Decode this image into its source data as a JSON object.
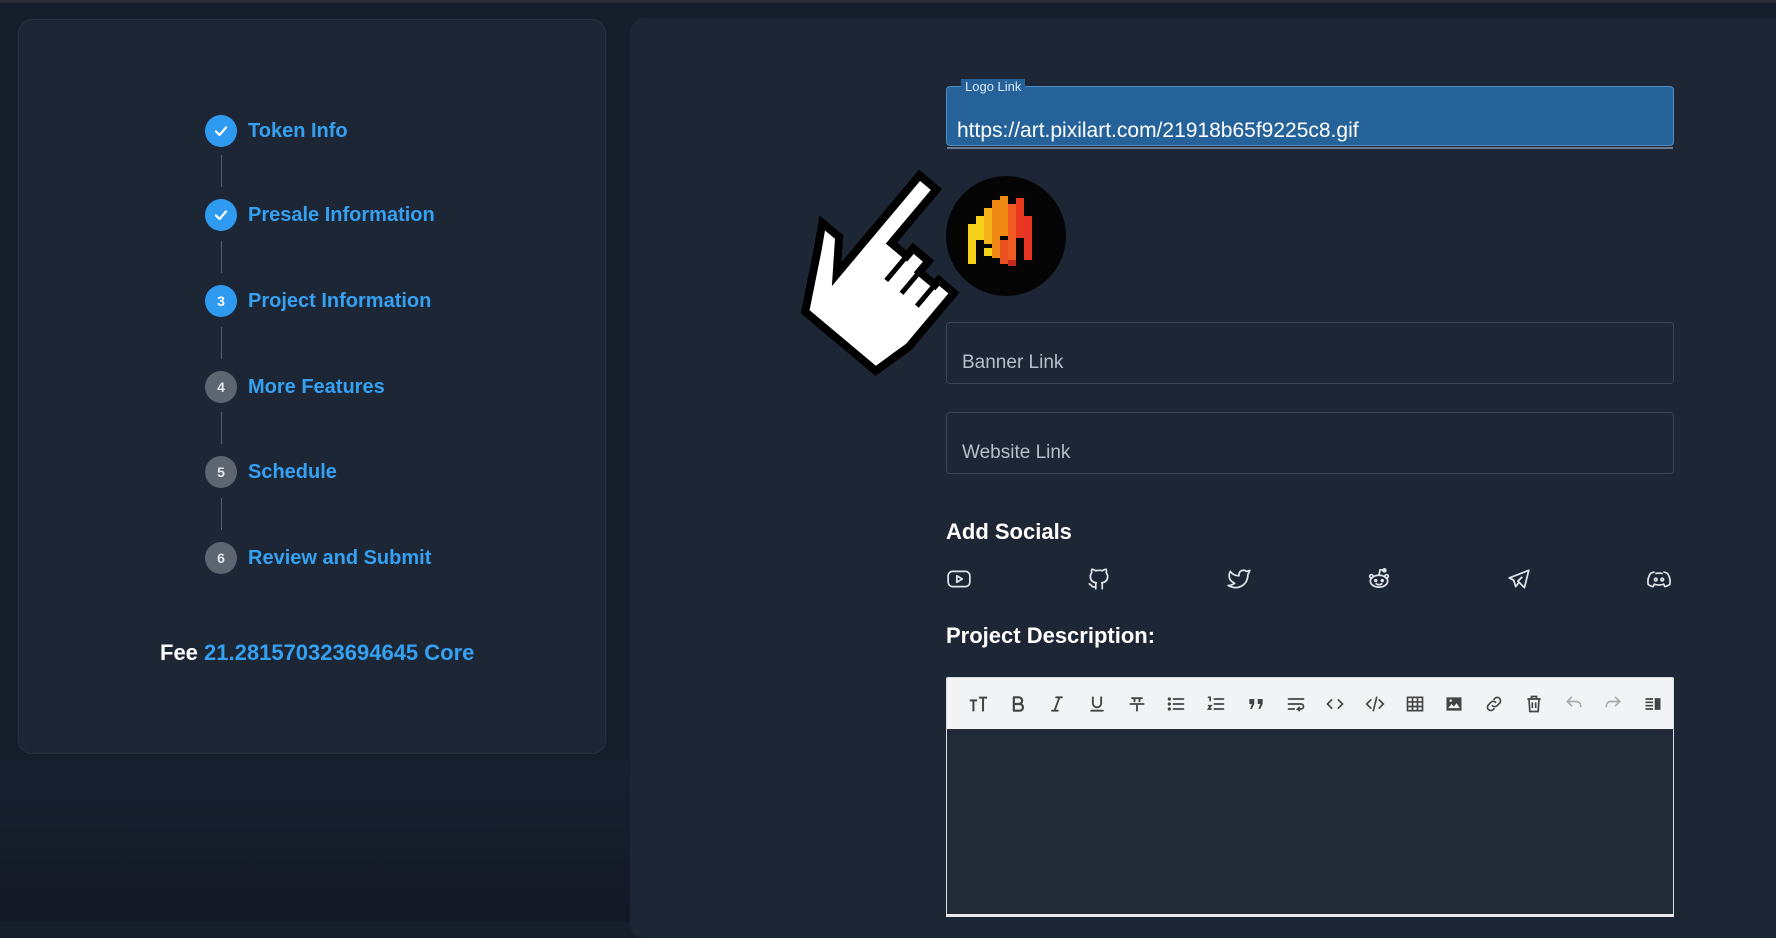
{
  "stepper": {
    "steps": [
      {
        "number": "1",
        "label": "Token Info",
        "status": "completed"
      },
      {
        "number": "2",
        "label": "Presale Information",
        "status": "completed"
      },
      {
        "number": "3",
        "label": "Project Information",
        "status": "active"
      },
      {
        "number": "4",
        "label": "More Features",
        "status": "pending"
      },
      {
        "number": "5",
        "label": "Schedule",
        "status": "pending"
      },
      {
        "number": "6",
        "label": "Review and Submit",
        "status": "pending"
      }
    ],
    "fee_label": "Fee",
    "fee_value": "21.281570323694645 Core"
  },
  "form": {
    "logo_link": {
      "label": "Logo Link",
      "value": "https://art.pixilart.com/21918b65f9225c8.gif"
    },
    "logo_preview_icon": "flame-logo-icon",
    "banner_link": {
      "placeholder": "Banner Link"
    },
    "website_link": {
      "placeholder": "Website Link"
    },
    "add_socials_title": "Add Socials",
    "socials": [
      "youtube-icon",
      "github-icon",
      "twitter-icon",
      "reddit-icon",
      "telegram-icon",
      "discord-icon"
    ],
    "project_description_title": "Project Description:",
    "editor_toolbar": [
      "text-size-icon",
      "bold-icon",
      "italic-icon",
      "underline-icon",
      "strikethrough-icon",
      "bullet-list-icon",
      "numbered-list-icon",
      "quote-icon",
      "wrap-text-icon",
      "code-icon",
      "code-block-icon",
      "table-icon",
      "image-icon",
      "link-icon",
      "delete-icon",
      "undo-icon",
      "redo-icon",
      "preview-icon"
    ]
  },
  "colors": {
    "accent": "#35a1f3",
    "background": "#161e2b",
    "card": "#1d2635",
    "logo_field_bg": "#25629a"
  }
}
